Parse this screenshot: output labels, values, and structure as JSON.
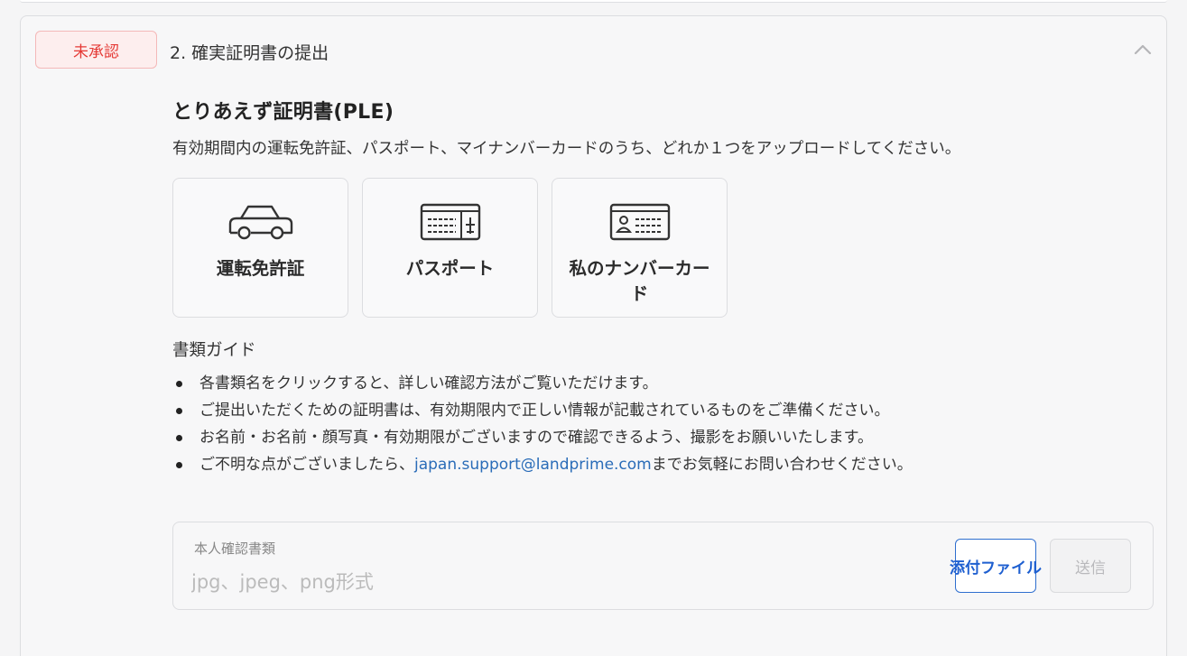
{
  "section": {
    "status_badge": "未承認",
    "title": "2. 確実証明書の提出",
    "collapse_icon": "chevron-up-icon"
  },
  "document": {
    "heading": "とりあえず証明書(PLE)",
    "description": "有効期間内の運転免許証、パスポート、マイナンバーカードのうち、どれか１つをアップロードしてください。"
  },
  "cards": [
    {
      "label": "運転免許証",
      "icon": "car-icon"
    },
    {
      "label": "パスポート",
      "icon": "passport-icon"
    },
    {
      "label": "私のナンバーカード",
      "icon": "id-card-icon"
    }
  ],
  "guide": {
    "title": "書類ガイド",
    "items": [
      "各書類名をクリックすると、詳しい確認方法がご覧いただけます。",
      "ご提出いただくための証明書は、有効期限内で正しい情報が記載されているものをご準備ください。",
      "お名前・お名前・顔写真・有効期限がございますので確認できるよう、撮影をお願いいたします。"
    ],
    "contact_prefix": "ご不明な点がございましたら、",
    "contact_email": "japan.support@landprime.com",
    "contact_suffix": "までお気軽にお問い合わせください。"
  },
  "upload": {
    "label": "本人確認書類",
    "placeholder": "jpg、jpeg、png形式",
    "attach_label": "添付ファイル",
    "submit_label": "送信"
  },
  "colors": {
    "badge_text": "#e53935",
    "badge_bg": "#fdeeee",
    "link": "#2a6cb8",
    "attach_accent": "#1e5fd0"
  }
}
